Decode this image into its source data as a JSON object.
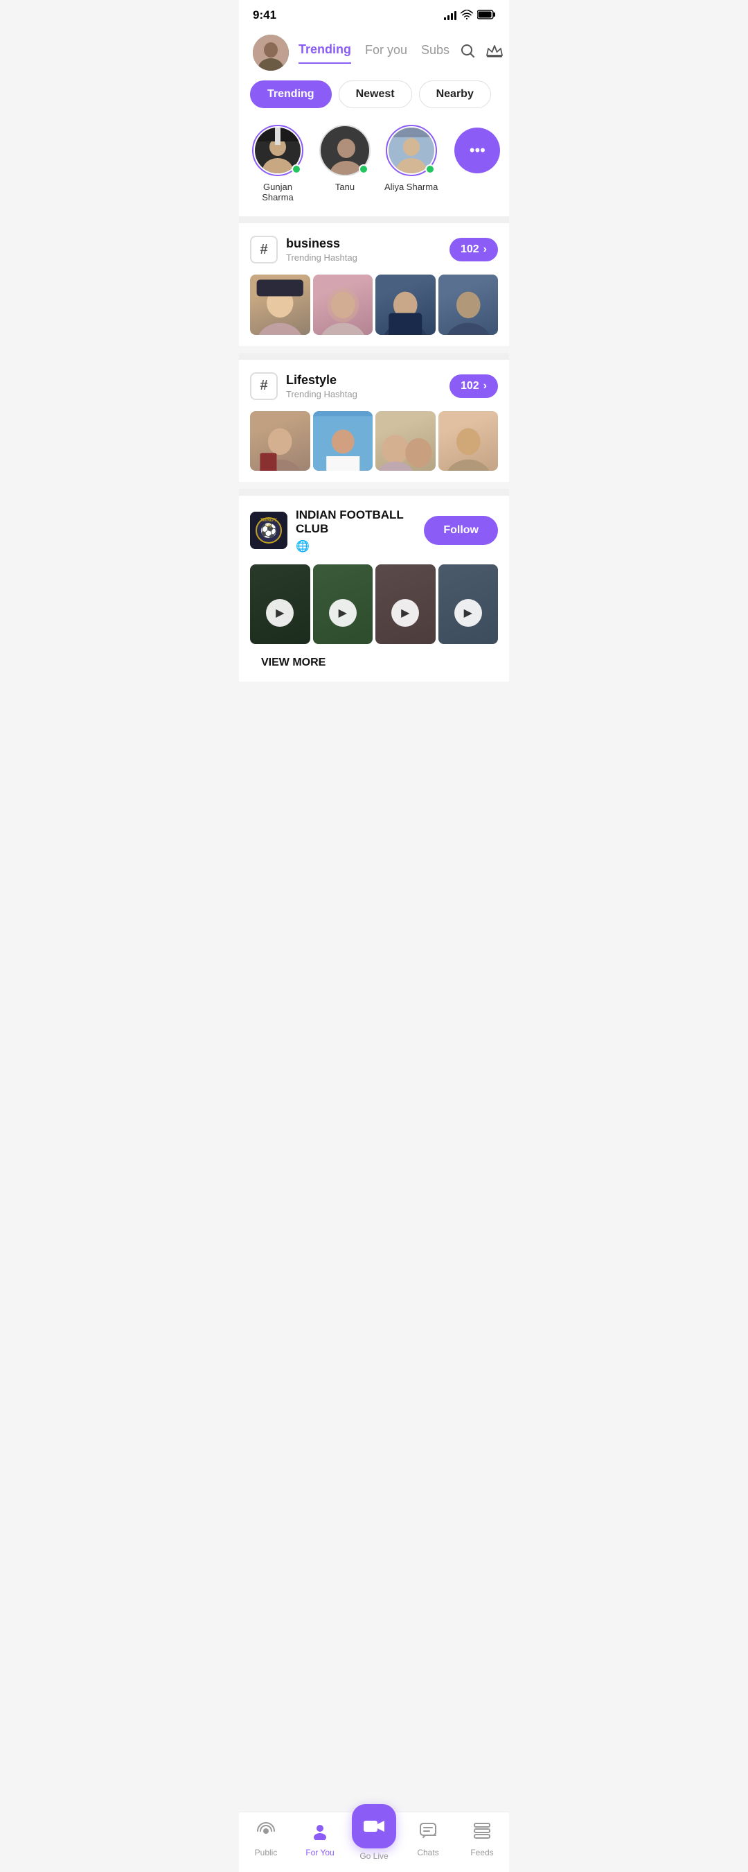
{
  "statusBar": {
    "time": "9:41"
  },
  "header": {
    "activeTab": "Trending",
    "tabs": [
      "Trending",
      "For you",
      "Subs"
    ]
  },
  "filterTabs": {
    "active": "Trending",
    "items": [
      "Trending",
      "Newest",
      "Nearby"
    ]
  },
  "stories": {
    "items": [
      {
        "name": "Gunjan Sharma",
        "online": true,
        "hasRing": true
      },
      {
        "name": "Tanu",
        "online": true,
        "hasRing": false
      },
      {
        "name": "Aliya Sharma",
        "online": true,
        "hasRing": true
      }
    ],
    "moreLabel": "..."
  },
  "hashtagCards": [
    {
      "tag": "business",
      "subtitle": "Trending Hashtag",
      "count": "102"
    },
    {
      "tag": "Lifestyle",
      "subtitle": "Trending Hashtag",
      "count": "102"
    }
  ],
  "clubCard": {
    "name": "INDIAN FOOTBALL CLUB",
    "logoEmoji": "⚽",
    "followLabel": "Follow",
    "viewMoreLabel": "VIEW MORE"
  },
  "bottomNav": {
    "items": [
      {
        "label": "Public",
        "icon": "radio"
      },
      {
        "label": "For You",
        "icon": "person",
        "active": true
      },
      {
        "label": "Go Live",
        "icon": "camera"
      },
      {
        "label": "Chats",
        "icon": "chat"
      },
      {
        "label": "Feeds",
        "icon": "feed"
      }
    ]
  }
}
